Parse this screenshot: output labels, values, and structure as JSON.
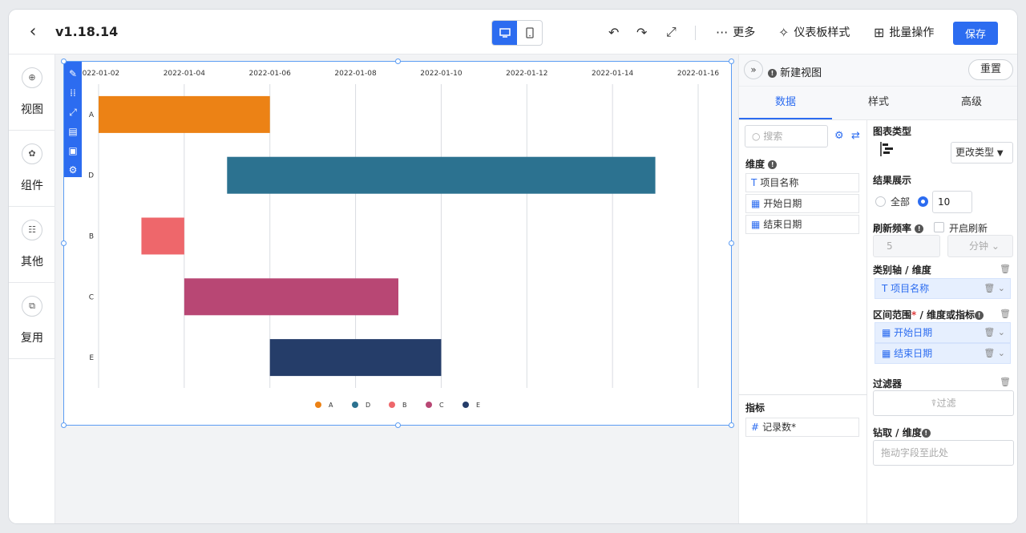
{
  "header": {
    "back_icon": "chevron-left-icon",
    "version": "v1.18.14",
    "undo_icon": "undo-icon",
    "redo_icon": "redo-icon",
    "fullscreen_icon": "expand-icon",
    "more_label": "更多",
    "dashboard_style_label": "仪表板样式",
    "batch_label": "批量操作",
    "save_label": "保存"
  },
  "sidebar": {
    "items": [
      {
        "label": "视图",
        "icon": "view-icon"
      },
      {
        "label": "组件",
        "icon": "component-icon"
      },
      {
        "label": "其他",
        "icon": "other-icon"
      },
      {
        "label": "复用",
        "icon": "reuse-icon"
      }
    ]
  },
  "chart_data": {
    "type": "gantt",
    "x_axis_position": "top",
    "x_ticks": [
      "2022-01-02",
      "2022-01-04",
      "2022-01-06",
      "2022-01-08",
      "2022-01-10",
      "2022-01-12",
      "2022-01-14",
      "2022-01-16"
    ],
    "grid": true,
    "legend": "bottom-center",
    "series": [
      {
        "name": "A",
        "start": "2022-01-02",
        "end": "2022-01-06",
        "color": "#ec8215"
      },
      {
        "name": "D",
        "start": "2022-01-05",
        "end": "2022-01-15",
        "color": "#2c7290"
      },
      {
        "name": "B",
        "start": "2022-01-03",
        "end": "2022-01-04",
        "color": "#ee676b"
      },
      {
        "name": "C",
        "start": "2022-01-04",
        "end": "2022-01-09",
        "color": "#b84774"
      },
      {
        "name": "E",
        "start": "2022-01-06",
        "end": "2022-01-10",
        "color": "#253d69"
      }
    ]
  },
  "panel": {
    "view_name": "新建视图",
    "reset_label": "重置",
    "tabs": [
      "数据",
      "样式",
      "高级"
    ],
    "search_placeholder": "搜索",
    "dimension_title": "维度",
    "dimensions": [
      {
        "icon": "T",
        "label": "项目名称"
      },
      {
        "icon": "▦",
        "label": "开始日期"
      },
      {
        "icon": "▦",
        "label": "结束日期"
      }
    ],
    "measure_title": "指标",
    "measures": [
      {
        "icon": "#",
        "label": "记录数*"
      }
    ],
    "chart_type_label": "图表类型",
    "change_type_label": "更改类型",
    "result_label": "结果展示",
    "result_all": "全部",
    "result_limit": "10",
    "refresh_label": "刷新频率",
    "refresh_enable": "开启刷新",
    "refresh_value": "5",
    "refresh_unit": "分钟",
    "category_axis_label": "类别轴 / 维度",
    "category_fields": [
      "项目名称"
    ],
    "range_label": "区间范围",
    "range_label_suffix": " / 维度或指标",
    "range_fields": [
      "开始日期",
      "结束日期"
    ],
    "filter_label": "过滤器",
    "filter_button": "过滤",
    "drill_label": "钻取 / 维度",
    "drill_placeholder": "拖动字段至此处"
  }
}
